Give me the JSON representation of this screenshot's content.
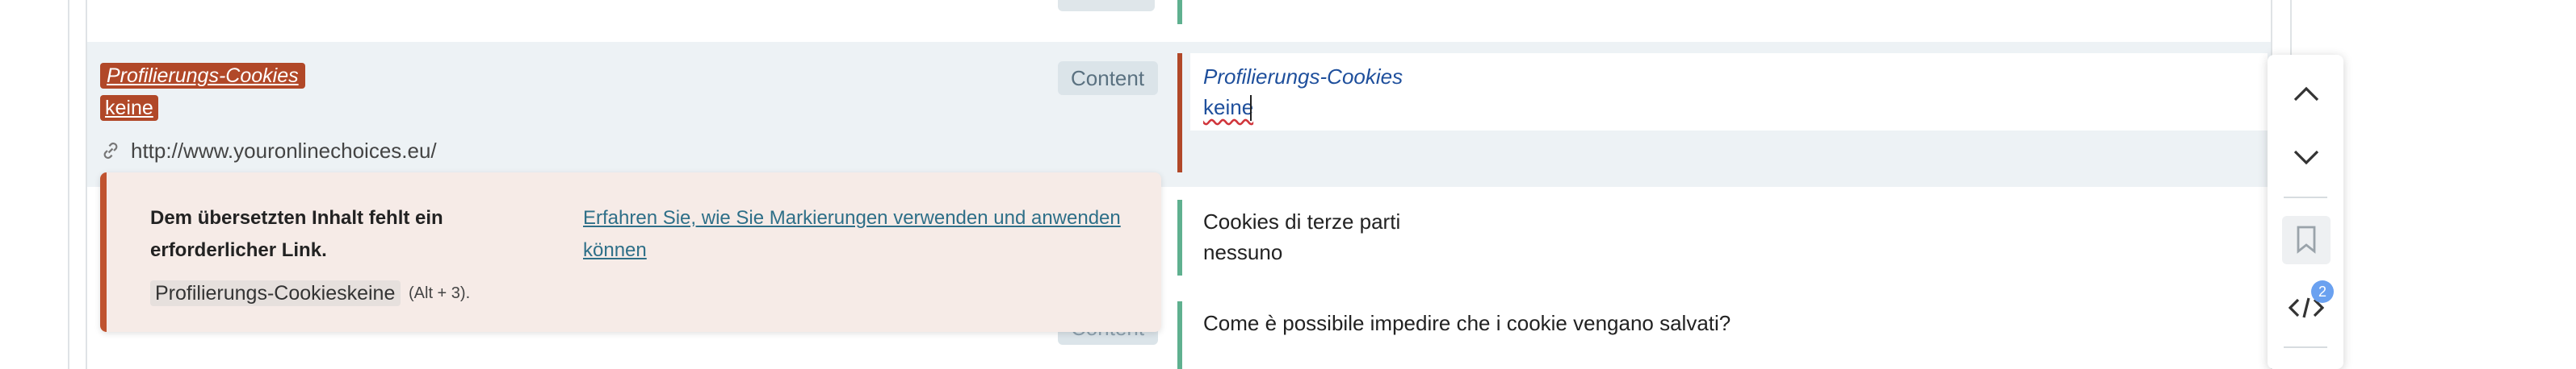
{
  "source": {
    "tag_title": "Profilierungs-Cookies",
    "tag_value": "keine",
    "badge": "Content",
    "link_url": "http://www.youronlinechoices.eu/",
    "under_badge": "Content",
    "under_text": "                                                         "
  },
  "target": {
    "active_title": "Profilierungs-Cookies",
    "active_value": "keine",
    "row2_line1": "Cookies di terze parti",
    "row2_line2": "nessuno",
    "row3_line1": "Come è possibile impedire che i cookie vengano salvati?"
  },
  "warning": {
    "title": "Dem übersetzten Inhalt fehlt ein erforderlicher Link.",
    "learn_link": "Erfahren Sie, wie Sie Markierungen verwenden und anwenden können",
    "chip": "Profilierungs-Cookieskeine",
    "shortcut": "(Alt + 3)."
  },
  "side_panel": {
    "badge_count": "2",
    "icons": [
      "chevron-up-icon",
      "chevron-down-icon",
      "bookmark-icon",
      "code-tag-icon"
    ]
  },
  "colors": {
    "tag_bg": "#b14828",
    "warning_bg": "#f6ebe7",
    "warning_border": "#c0532f",
    "target_bar_green": "#5fb08f",
    "target_text_blue": "#1e4f9c",
    "badge_blue": "#6aa1f0"
  }
}
